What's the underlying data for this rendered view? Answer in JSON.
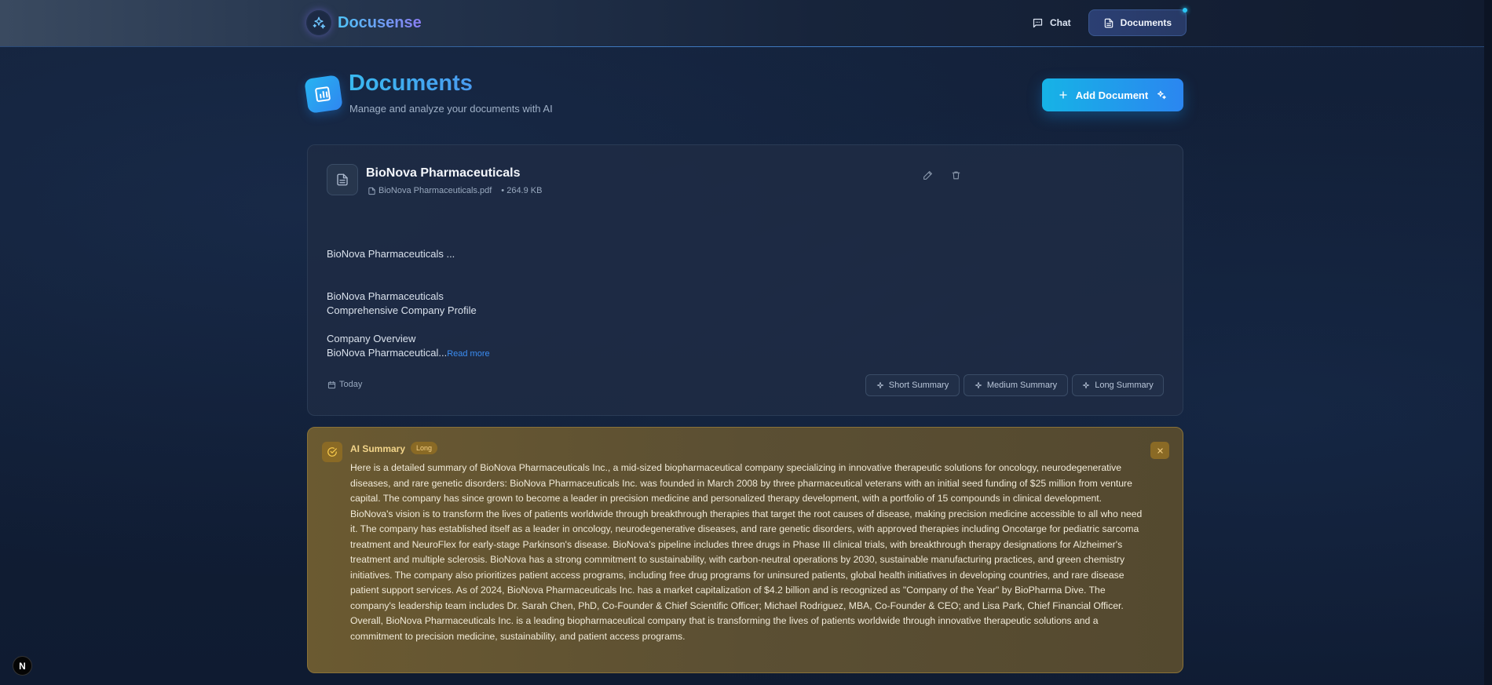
{
  "app": {
    "name": "Docusense"
  },
  "nav": {
    "chat_label": "Chat",
    "documents_label": "Documents"
  },
  "page": {
    "title": "Documents",
    "subtitle": "Manage and analyze your documents with AI",
    "add_button": "Add Document"
  },
  "document": {
    "title": "BioNova Pharmaceuticals",
    "filename": "BioNova Pharmaceuticals.pdf",
    "size": "• 264.9 KB",
    "preview_line1": "BioNova Pharmaceuticals ...",
    "preview_line2": "BioNova Pharmaceuticals",
    "preview_line3": "Comprehensive Company Profile",
    "preview_line4": "Company Overview",
    "preview_line5": "BioNova Pharmaceutical...",
    "read_more": "Read more",
    "date": "Today",
    "summary_buttons": [
      "Short Summary",
      "Medium Summary",
      "Long Summary"
    ]
  },
  "ai_summary": {
    "title": "AI Summary",
    "badge": "Long",
    "text": "Here is a detailed summary of BioNova Pharmaceuticals Inc., a mid-sized biopharmaceutical company specializing in innovative therapeutic solutions for oncology, neurodegenerative diseases, and rare genetic disorders: BioNova Pharmaceuticals Inc. was founded in March 2008 by three pharmaceutical veterans with an initial seed funding of $25 million from venture capital. The company has since grown to become a leader in precision medicine and personalized therapy development, with a portfolio of 15 compounds in clinical development. BioNova's vision is to transform the lives of patients worldwide through breakthrough therapies that target the root causes of disease, making precision medicine accessible to all who need it. The company has established itself as a leader in oncology, neurodegenerative diseases, and rare genetic disorders, with approved therapies including Oncotarge for pediatric sarcoma treatment and NeuroFlex for early-stage Parkinson's disease. BioNova's pipeline includes three drugs in Phase III clinical trials, with breakthrough therapy designations for Alzheimer's treatment and multiple sclerosis. BioNova has a strong commitment to sustainability, with carbon-neutral operations by 2030, sustainable manufacturing practices, and green chemistry initiatives. The company also prioritizes patient access programs, including free drug programs for uninsured patients, global health initiatives in developing countries, and rare disease patient support services. As of 2024, BioNova Pharmaceuticals Inc. has a market capitalization of $4.2 billion and is recognized as \"Company of the Year\" by BioPharma Dive. The company's leadership team includes Dr. Sarah Chen, PhD, Co-Founder & Chief Scientific Officer; Michael Rodriguez, MBA, Co-Founder & CEO; and Lisa Park, Chief Financial Officer. Overall, BioNova Pharmaceuticals Inc. is a leading biopharmaceutical company that is transforming the lives of patients worldwide through innovative therapeutic solutions and a commitment to precision medicine, sustainability, and patient access programs."
  },
  "corner_badge": "N",
  "colors": {
    "accent": "#2b86f0",
    "summary_bg": "#5b4f33",
    "summary_text": "#f3d58a"
  }
}
